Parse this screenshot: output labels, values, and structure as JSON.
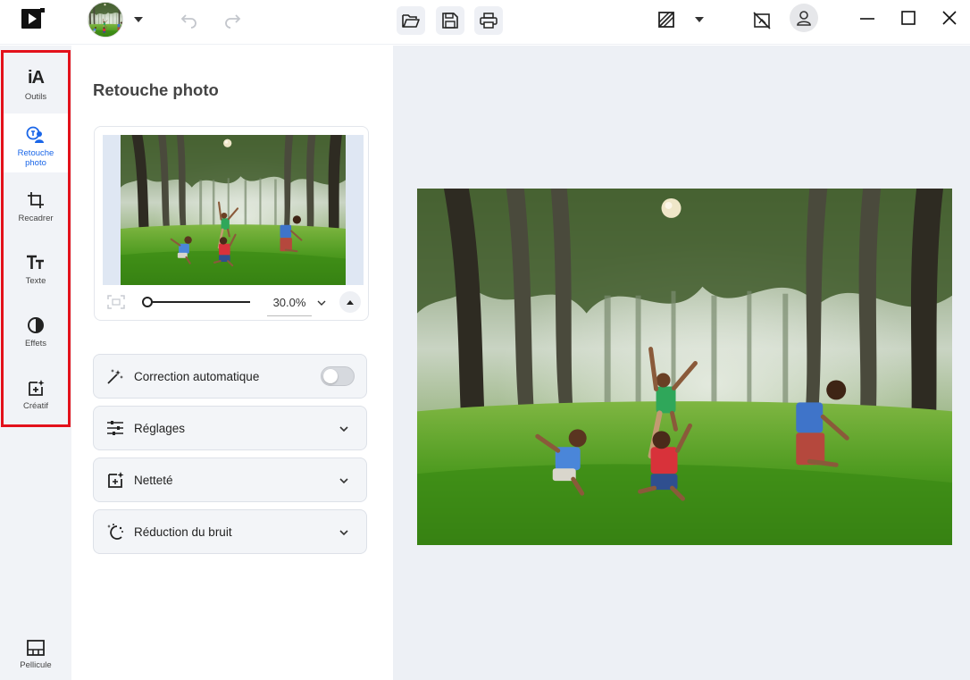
{
  "titlebar": {
    "app_icon": "app-logo-icon",
    "avatar": "user-photo-avatar",
    "undo_icon": "undo-icon",
    "redo_icon": "redo-icon",
    "open_icon": "folder-open-icon",
    "save_icon": "save-icon",
    "print_icon": "print-icon",
    "compare_icon": "compare-icon",
    "crop_off_icon": "crop-off-icon",
    "account_icon": "account-icon",
    "window_controls": [
      "minimize-icon",
      "maximize-icon",
      "close-icon"
    ]
  },
  "rail": {
    "items": [
      {
        "label": "Outils",
        "icon": "ai-tools-icon"
      },
      {
        "label": "Retouche\nphoto",
        "icon": "retouch-icon",
        "active": true
      },
      {
        "label": "Recadrer",
        "icon": "crop-icon"
      },
      {
        "label": "Texte",
        "icon": "text-icon"
      },
      {
        "label": "Effets",
        "icon": "effects-icon"
      },
      {
        "label": "Créatif",
        "icon": "creative-icon"
      }
    ],
    "bottom": {
      "label": "Pellicule",
      "icon": "filmstrip-icon"
    },
    "tool_badge": "iA",
    "highlight_color": "#e3111b",
    "accent_color": "#1a66e8"
  },
  "panel": {
    "title": "Retouche photo",
    "navigator": {
      "zoom_value": "30.0%",
      "zoom_fraction": 0.0
    },
    "sections": [
      {
        "label": "Correction automatique",
        "icon": "magic-wand-icon",
        "toggle": false
      },
      {
        "label": "Réglages",
        "icon": "sliders-icon"
      },
      {
        "label": "Netteté",
        "icon": "sharpen-icon"
      },
      {
        "label": "Réduction du bruit",
        "icon": "denoise-icon"
      }
    ]
  }
}
